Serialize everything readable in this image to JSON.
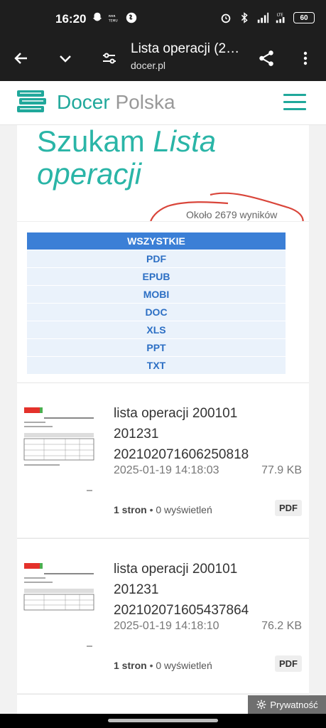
{
  "status_bar": {
    "time": "16:20",
    "notif_icons": [
      "snapchat-icon",
      "temu-icon",
      "shazam-icon"
    ],
    "right_icons": [
      "alarm-icon",
      "bluetooth-icon",
      "signal-icon",
      "lte-signal-icon"
    ],
    "battery": "60"
  },
  "toolbar": {
    "title": "Lista operacji (2…",
    "url": "docer.pl"
  },
  "site": {
    "logo_first": "Docer",
    "logo_second": "Polska"
  },
  "search": {
    "prefix": "Szukam",
    "query_line1": "Lista",
    "query_line2": "operacji",
    "count": "Około 2679 wyników"
  },
  "filters": [
    "WSZYSTKIE",
    "PDF",
    "EPUB",
    "MOBI",
    "DOC",
    "XLS",
    "PPT",
    "TXT"
  ],
  "active_filter": "WSZYSTKIE",
  "documents": [
    {
      "title": "lista operacji 200101 201231 20210207160625081 8",
      "title_display": "lista operacji 200101 201231 202102071606250818",
      "date": "2025-01-19 14:18:03",
      "size": "77.9 KB",
      "pages": "1 stron",
      "views": "0 wyświetleń",
      "format": "PDF"
    },
    {
      "title_display": "lista operacji 200101 201231 202102071605437864",
      "date": "2025-01-19 14:18:10",
      "size": "76.2 KB",
      "pages": "1 stron",
      "views": "0 wyświetleń",
      "format": "PDF"
    }
  ],
  "privacy_label": "Prywatność",
  "colors": {
    "brand": "#20a89b",
    "accent_blue": "#3b7fd6",
    "annotation_red": "#d9453a"
  }
}
